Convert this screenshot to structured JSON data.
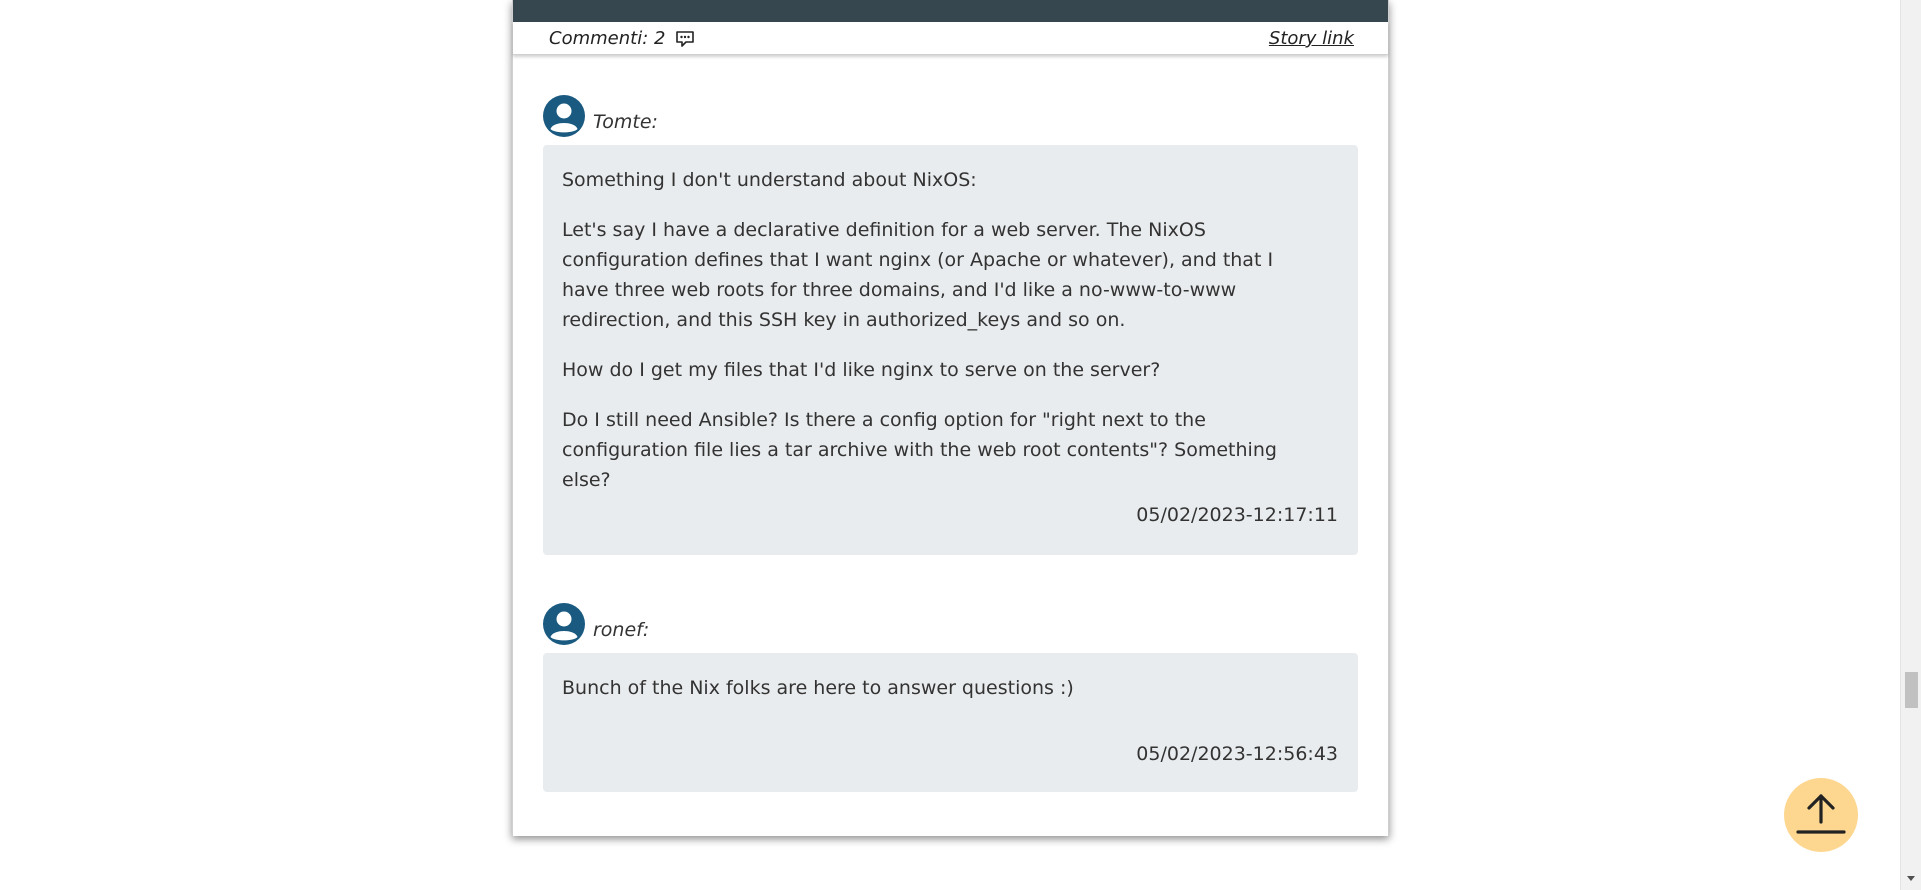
{
  "article": {
    "comments_label": "Commenti: 2",
    "story_link_label": "Story link"
  },
  "comments": [
    {
      "author": "Tomte:",
      "paragraphs": [
        "Something I don't understand about NixOS:",
        "Let's say I have a declarative definition for a web server. The NixOS configuration defines that I want nginx (or Apache or whatever), and that I have three web roots for three domains, and I'd like a no-www-to-www redirection, and this SSH key in authorized_keys and so on.",
        "How do I get my files that I'd like nginx to serve on the server?",
        "Do I still need Ansible? Is there a config option for \"right next to the configuration file lies a tar archive with the web root contents\"? Something else?"
      ],
      "timestamp": "05/02/2023-12:17:11"
    },
    {
      "author": "ronef:",
      "paragraphs": [
        "Bunch of the Nix folks are here to answer questions :)"
      ],
      "timestamp": "05/02/2023-12:56:43"
    }
  ],
  "icons": {
    "comment": "comment-icon",
    "avatar": "user-avatar-icon",
    "scroll_top": "arrow-up-icon"
  },
  "colors": {
    "header_bar": "#36474f",
    "comment_bg": "#e9ecee",
    "avatar": "#1a5a80",
    "scroll_top_bg": "#fdd790"
  }
}
